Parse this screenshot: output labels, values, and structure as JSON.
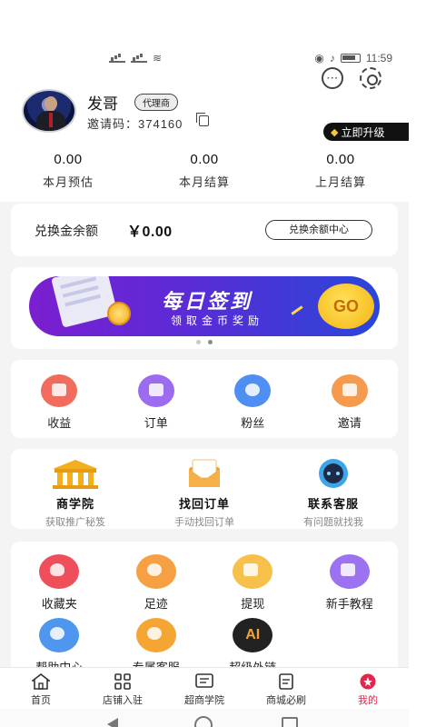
{
  "status_bar": {
    "left_text": "4G 4G",
    "time": "11:59"
  },
  "profile": {
    "name": "发哥",
    "role_badge": "代理商",
    "invite_text": "邀请码：374160",
    "upgrade_label": "立即升级"
  },
  "stats": [
    {
      "value": "0.00",
      "label": "本月预估"
    },
    {
      "value": "0.00",
      "label": "本月结算"
    },
    {
      "value": "0.00",
      "label": "上月结算"
    }
  ],
  "balance": {
    "label": "兑换金余额",
    "amount": "￥0.00",
    "button_label": "兑换余额中心"
  },
  "banner": {
    "title": "每日签到",
    "subtitle": "领取金币奖励",
    "go_label": "GO"
  },
  "main_grid": [
    {
      "label": "收益",
      "icon": "income-icon",
      "color": "#f16c5c"
    },
    {
      "label": "订单",
      "icon": "order-icon",
      "color": "#9b6cf0"
    },
    {
      "label": "粉丝",
      "icon": "fans-icon",
      "color": "#4f8ef2"
    },
    {
      "label": "邀请",
      "icon": "invite-icon",
      "color": "#f69a4e"
    }
  ],
  "feature_grid": [
    {
      "title": "商学院",
      "sub": "获取推广秘笈",
      "icon": "academy-icon"
    },
    {
      "title": "找回订单",
      "sub": "手动找回订单",
      "icon": "find-order-icon"
    },
    {
      "title": "联系客服",
      "sub": "有问题就找我",
      "icon": "customer-service-icon"
    }
  ],
  "tools_grid": [
    {
      "label": "收藏夹",
      "icon": "favorites-icon",
      "color": "#ef4f5b"
    },
    {
      "label": "足迹",
      "icon": "footprint-icon",
      "color": "#f6a043"
    },
    {
      "label": "提现",
      "icon": "withdraw-icon",
      "color": "#f7c04a"
    },
    {
      "label": "新手教程",
      "icon": "tutorial-icon",
      "color": "#9d72f0"
    },
    {
      "label": "帮助中心",
      "icon": "help-icon",
      "color": "#4f96ee"
    },
    {
      "label": "专属客服",
      "icon": "search-service-icon",
      "color": "#f5a534"
    },
    {
      "label": "超级外链",
      "icon": "ai-icon",
      "color": "#222222"
    }
  ],
  "tabbar": [
    {
      "label": "首页",
      "icon": "home-icon",
      "active": false
    },
    {
      "label": "店铺入驻",
      "icon": "grid-icon",
      "active": false
    },
    {
      "label": "超商学院",
      "icon": "message-icon",
      "active": false
    },
    {
      "label": "商城必刷",
      "icon": "document-icon",
      "active": false
    },
    {
      "label": "我的",
      "icon": "profile-icon",
      "active": true
    }
  ],
  "colors": {
    "accent": "#e2264d",
    "banner_start": "#7b1fd0",
    "banner_end": "#2a46d8"
  }
}
